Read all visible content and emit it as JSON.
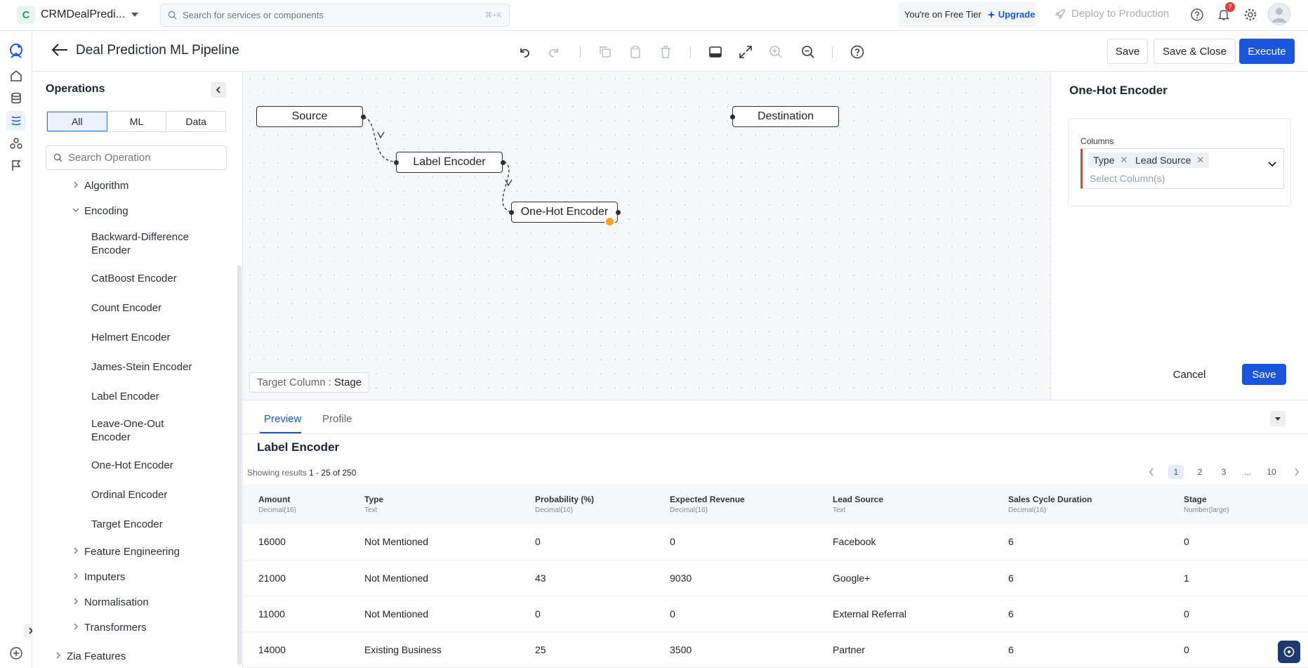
{
  "topbar": {
    "project_initial": "C",
    "project_name": "CRMDealPredi...",
    "search_placeholder": "Search for services or components",
    "search_shortcut": "⌘+K",
    "free_tier_text": "You're on Free Tier",
    "upgrade_label": "Upgrade",
    "deploy_label": "Deploy to Production",
    "notification_count": "7"
  },
  "header": {
    "title": "Deal Prediction ML Pipeline",
    "save_label": "Save",
    "save_close_label": "Save & Close",
    "execute_label": "Execute"
  },
  "operations": {
    "heading": "Operations",
    "filters": [
      "All",
      "ML",
      "Data"
    ],
    "active_filter": "All",
    "search_placeholder": "Search Operation",
    "tree": {
      "algorithm": "Algorithm",
      "encoding": "Encoding",
      "encoders": [
        "Backward-Difference Encoder",
        "CatBoost Encoder",
        "Count Encoder",
        "Helmert Encoder",
        "James-Stein Encoder",
        "Label Encoder",
        "Leave-One-Out Encoder",
        "One-Hot Encoder",
        "Ordinal Encoder",
        "Target Encoder"
      ],
      "feature_engineering": "Feature Engineering",
      "imputers": "Imputers",
      "normalisation": "Normalisation",
      "transformers": "Transformers",
      "zia_features": "Zia Features"
    }
  },
  "canvas": {
    "nodes": {
      "source": "Source",
      "label_encoder": "Label Encoder",
      "one_hot_encoder": "One-Hot Encoder",
      "destination": "Destination"
    },
    "target_column_label": "Target Column :",
    "target_column_value": "Stage"
  },
  "config_panel": {
    "title": "One-Hot Encoder",
    "columns_label": "Columns",
    "selected_columns": [
      "Type",
      "Lead Source"
    ],
    "select_placeholder": "Select Column(s)",
    "cancel_label": "Cancel",
    "save_label": "Save"
  },
  "preview": {
    "tabs": [
      "Preview",
      "Profile"
    ],
    "active_tab": "Preview",
    "title": "Label Encoder",
    "showing_prefix": "Showing results",
    "showing_range": "1 - 25 of 250",
    "pages": [
      "1",
      "2",
      "3",
      "...",
      "10"
    ],
    "current_page": "1",
    "columns": [
      {
        "name": "Amount",
        "type": "Decimal(16)"
      },
      {
        "name": "Type",
        "type": "Text"
      },
      {
        "name": "Probability (%)",
        "type": "Decimal(16)"
      },
      {
        "name": "Expected Revenue",
        "type": "Decimal(16)"
      },
      {
        "name": "Lead Source",
        "type": "Text"
      },
      {
        "name": "Sales Cycle Duration",
        "type": "Decimal(16)"
      },
      {
        "name": "Stage",
        "type": "Number(large)"
      }
    ],
    "rows": [
      [
        "16000",
        "Not Mentioned",
        "0",
        "0",
        "Facebook",
        "6",
        "0"
      ],
      [
        "21000",
        "Not Mentioned",
        "43",
        "9030",
        "Google+",
        "6",
        "1"
      ],
      [
        "11000",
        "Not Mentioned",
        "0",
        "0",
        "External Referral",
        "6",
        "0"
      ],
      [
        "14000",
        "Existing Business",
        "25",
        "3500",
        "Partner",
        "6",
        "0"
      ]
    ]
  },
  "colors": {
    "accent": "#1a56db",
    "error": "#e0403a",
    "node_badge": "#f5a623"
  }
}
